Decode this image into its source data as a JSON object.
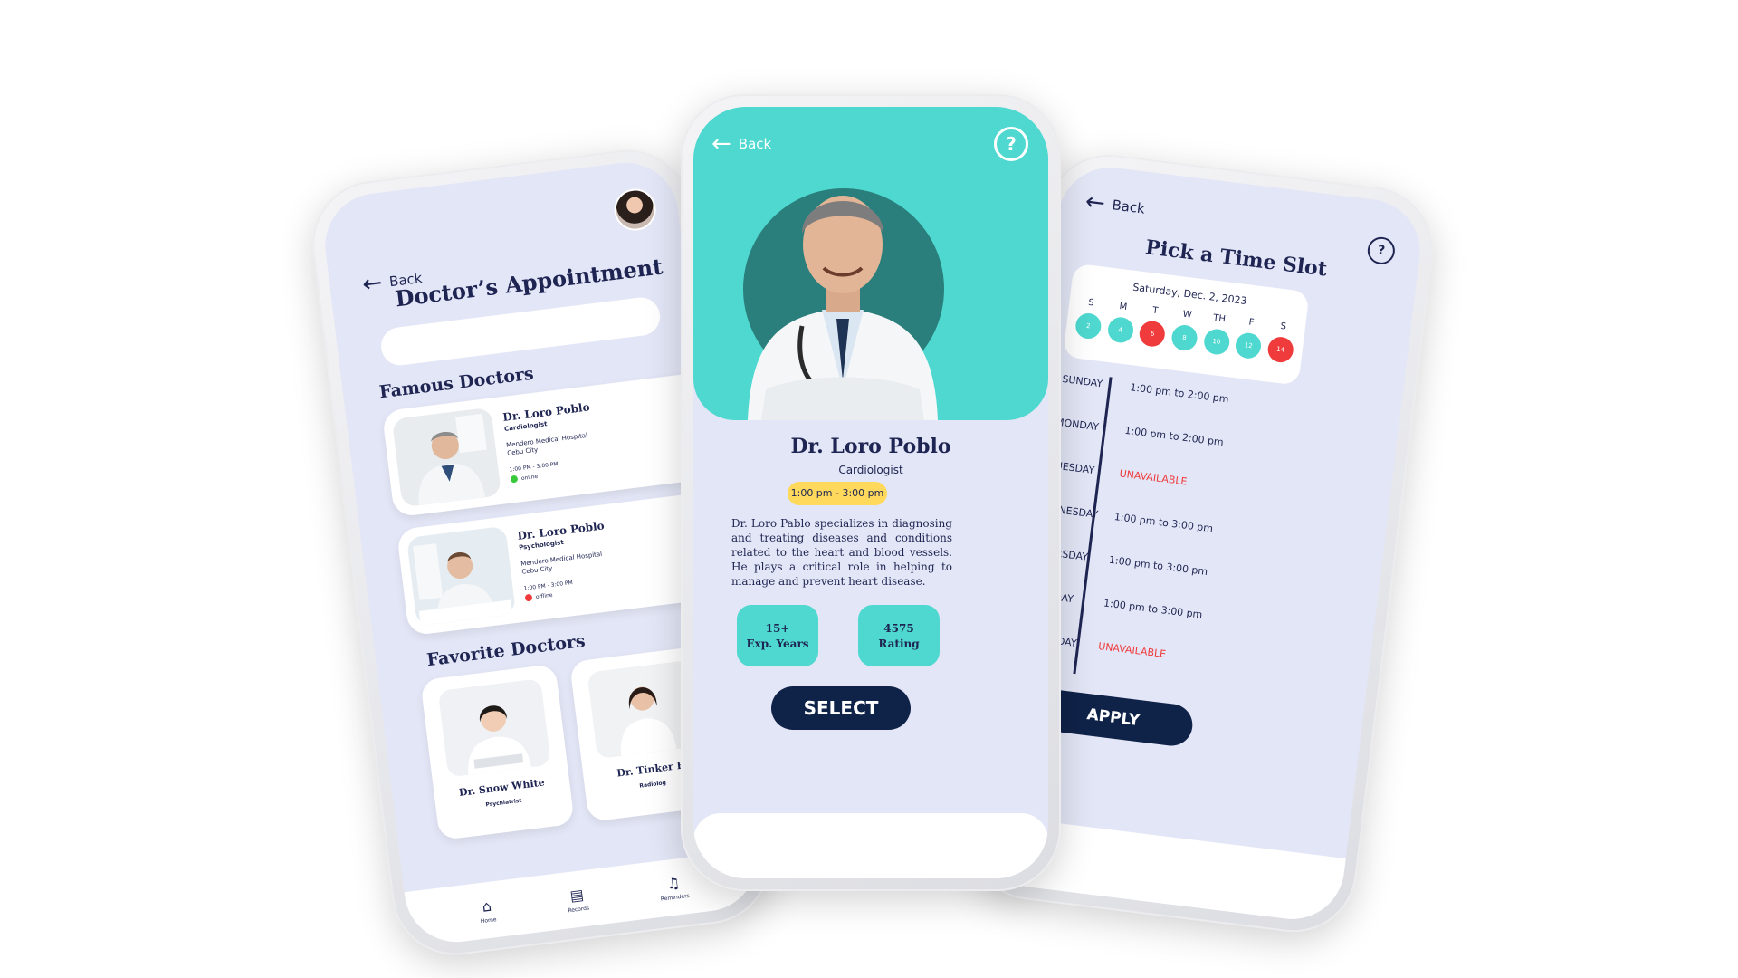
{
  "left": {
    "back_label": "Back",
    "title": "Doctor’s Appointment",
    "famous_title": "Famous Doctors",
    "famous": [
      {
        "name": "Dr. Loro Poblo",
        "specialty": "Cardiologist",
        "hospital": "Mendero Medical Hospital",
        "city": "Cebu City",
        "time": "1:00 PM - 3:00 PM",
        "status": "online"
      },
      {
        "name": "Dr. Loro Poblo",
        "specialty": "Psychologist",
        "hospital": "Mendero Medical Hospital",
        "city": "Cebu City",
        "time": "1:00 PM - 3:00 PM",
        "status": "offline"
      }
    ],
    "favorite_title": "Favorite Doctors",
    "favorites": [
      {
        "name": "Dr. Snow White",
        "specialty": "Psychiatrist"
      },
      {
        "name": "Dr. Tinker B",
        "specialty": "Radiolog"
      }
    ],
    "tabs": {
      "home": "Home",
      "records": "Records",
      "reminders": "Reminders"
    }
  },
  "center": {
    "back_label": "Back",
    "help_label": "?",
    "name": "Dr. Loro Poblo",
    "specialty": "Cardiologist",
    "hours": "1:00 pm - 3:00 pm",
    "description": "Dr. Loro Pablo specializes in diagnosing and treating diseases and conditions related to the heart and blood vessels. He plays a critical role in helping to manage and prevent heart disease.",
    "stat_exp_value": "15+",
    "stat_exp_label": "Exp. Years",
    "stat_rating_value": "4575",
    "stat_rating_label": "Rating",
    "select_label": "SELECT"
  },
  "right": {
    "back_label": "Back",
    "help_label": "?",
    "title": "Pick a Time Slot",
    "date": "Saturday, Dec. 2, 2023",
    "days": [
      {
        "label": "S",
        "num": "2",
        "state": "available"
      },
      {
        "label": "M",
        "num": "4",
        "state": "available"
      },
      {
        "label": "T",
        "num": "6",
        "state": "unavailable"
      },
      {
        "label": "W",
        "num": "8",
        "state": "available"
      },
      {
        "label": "TH",
        "num": "10",
        "state": "available"
      },
      {
        "label": "F",
        "num": "12",
        "state": "available"
      },
      {
        "label": "S",
        "num": "14",
        "state": "unavailable"
      }
    ],
    "schedule": [
      {
        "day": "SUNDAY",
        "slot": "1:00 pm to 2:00 pm"
      },
      {
        "day": "MONDAY",
        "slot": "1:00 pm to 2:00 pm"
      },
      {
        "day": "TUESDAY",
        "slot": "UNAVAILABLE"
      },
      {
        "day": "WEDNESDAY",
        "slot": "1:00 pm to 3:00 pm"
      },
      {
        "day": "THURSDAY",
        "slot": "1:00 pm to 3:00 pm"
      },
      {
        "day": "FRIDAY",
        "slot": "1:00 pm to 3:00 pm"
      },
      {
        "day": "SATURDAY",
        "slot": "UNAVAILABLE"
      }
    ],
    "apply_label": "APPLY"
  },
  "colors": {
    "teal": "#4ed8cf",
    "navy": "#0f2248",
    "red": "#ef3b3b",
    "green": "#37c93b",
    "yellow": "#ffd95c",
    "lavender": "#e3e6f6"
  }
}
